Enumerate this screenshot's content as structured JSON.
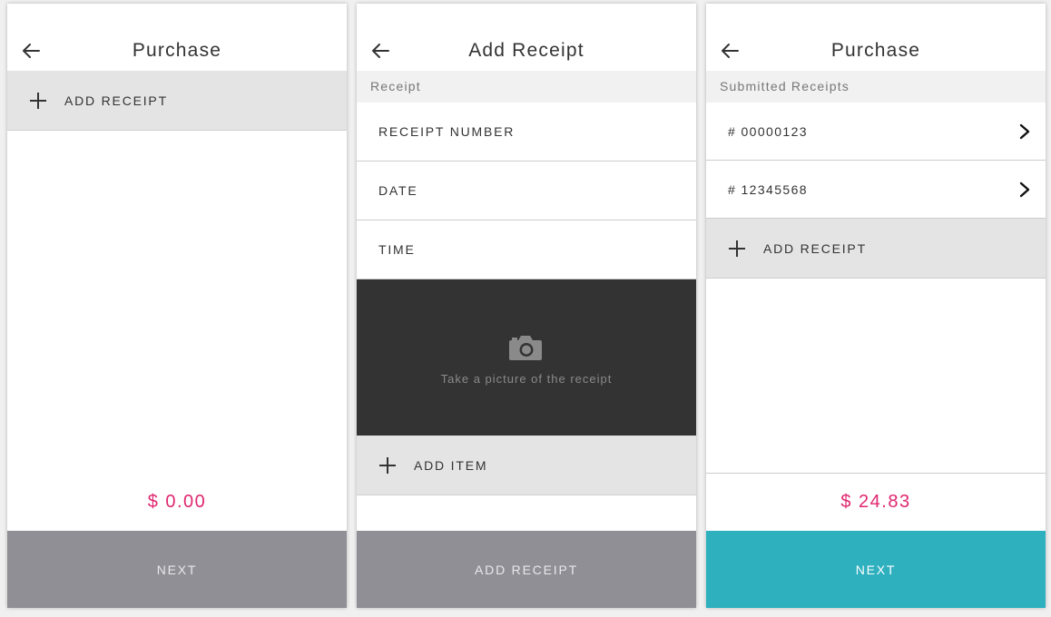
{
  "colors": {
    "accent_pink": "#e0266f",
    "teal_button": "#2eb0bf",
    "disabled_button": "#918f96",
    "camera_bg": "#333333"
  },
  "screens": [
    {
      "title": "Purchase",
      "back_icon": "arrow-left-icon",
      "add_receipt_label": "ADD RECEIPT",
      "total": "$ 0.00",
      "next_label": "NEXT"
    },
    {
      "title": "Add Receipt",
      "back_icon": "arrow-left-icon",
      "section_label": "Receipt",
      "fields": [
        "RECEIPT NUMBER",
        "DATE",
        "TIME"
      ],
      "camera_icon": "camera-icon",
      "camera_text": "Take a picture of the receipt",
      "add_item_label": "ADD ITEM",
      "submit_label": "ADD RECEIPT"
    },
    {
      "title": "Purchase",
      "back_icon": "arrow-left-icon",
      "section_label": "Submitted Receipts",
      "receipts": [
        "# 00000123",
        "# 12345568"
      ],
      "add_receipt_label": "ADD RECEIPT",
      "total": "$ 24.83",
      "next_label": "NEXT"
    }
  ]
}
